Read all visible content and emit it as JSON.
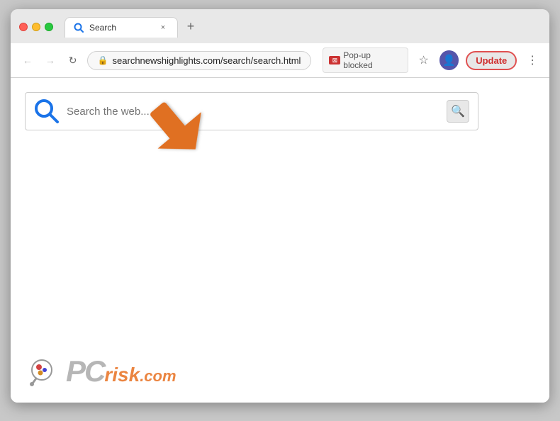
{
  "browser": {
    "title": "Search",
    "tab": {
      "title": "Search",
      "close_label": "×",
      "new_tab_label": "+"
    },
    "nav": {
      "back_label": "←",
      "forward_label": "→",
      "reload_label": "↻",
      "url": "searchnewshighlights.com/search/search.html"
    },
    "popup_blocked_label": "Pop-up blocked",
    "star_label": "☆",
    "update_label": "Update",
    "menu_label": "⋮"
  },
  "page": {
    "search_placeholder": "Search the web...",
    "search_go_icon": "🔍"
  },
  "watermark": {
    "pc_label": "PC",
    "risk_label": "risk",
    "domain_label": ".com"
  },
  "colors": {
    "search_blue": "#1a73e8",
    "arrow_orange": "#e07020",
    "update_red": "#cc3333",
    "pcrisk_gray": "#aaaaaa",
    "pcrisk_orange": "#e87020"
  }
}
